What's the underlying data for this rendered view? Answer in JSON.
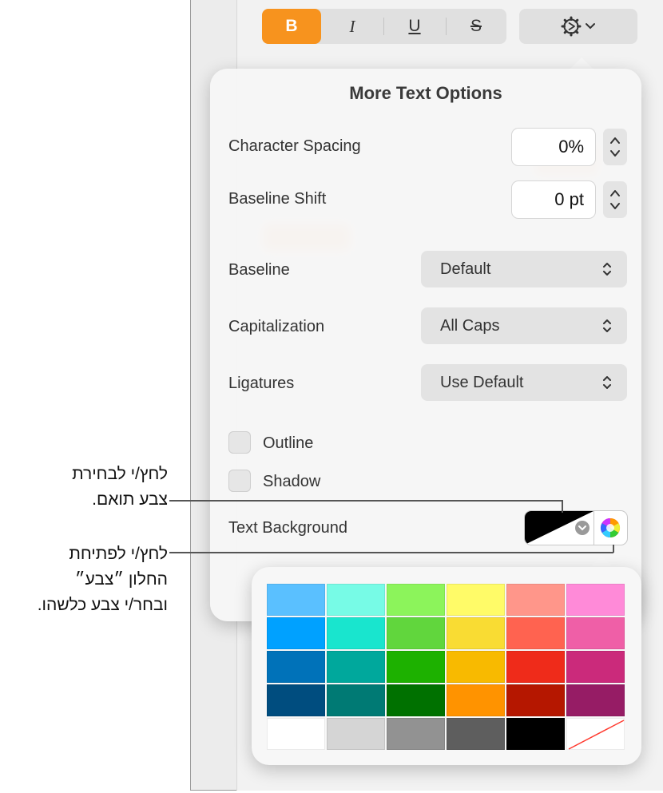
{
  "toolbar": {
    "bold_label": "B",
    "italic_label": "I",
    "underline_label": "U",
    "strike_label": "S",
    "gear_icon": "gear-icon",
    "chevron_icon": "chevron-down-icon"
  },
  "popover": {
    "title": "More Text Options",
    "character_spacing": {
      "label": "Character Spacing",
      "value": "0%"
    },
    "baseline_shift": {
      "label": "Baseline Shift",
      "value": "0 pt"
    },
    "baseline": {
      "label": "Baseline",
      "value": "Default"
    },
    "capitalization": {
      "label": "Capitalization",
      "value": "All Caps"
    },
    "ligatures": {
      "label": "Ligatures",
      "value": "Use Default"
    },
    "outline": {
      "label": "Outline",
      "checked": false
    },
    "shadow": {
      "label": "Shadow",
      "checked": false
    },
    "text_background": {
      "label": "Text Background",
      "color": "#000000"
    }
  },
  "callouts": {
    "matching_color": [
      "לחץ/י לבחירת",
      "צבע תואם."
    ],
    "color_window": [
      "לחץ/י לפתיחת",
      "החלון ״צבע״",
      "ובחר/י צבע כלשהו."
    ]
  },
  "palette": {
    "rows": [
      [
        "#5ac0ff",
        "#77fbe6",
        "#8cf45b",
        "#fffb68",
        "#ff968a",
        "#ff8ad8"
      ],
      [
        "#00a1ff",
        "#19e5ce",
        "#61d63d",
        "#f9dc33",
        "#ff6350",
        "#ef5fa7"
      ],
      [
        "#0072b9",
        "#00a89c",
        "#1db100",
        "#f8ba00",
        "#ef2b1a",
        "#cb2a7b"
      ],
      [
        "#004d7f",
        "#007a74",
        "#007100",
        "#ff9300",
        "#b51700",
        "#961c65"
      ],
      [
        "#ffffff",
        "#d5d5d5",
        "#929292",
        "#5e5e5e",
        "#000000",
        "none"
      ]
    ]
  }
}
